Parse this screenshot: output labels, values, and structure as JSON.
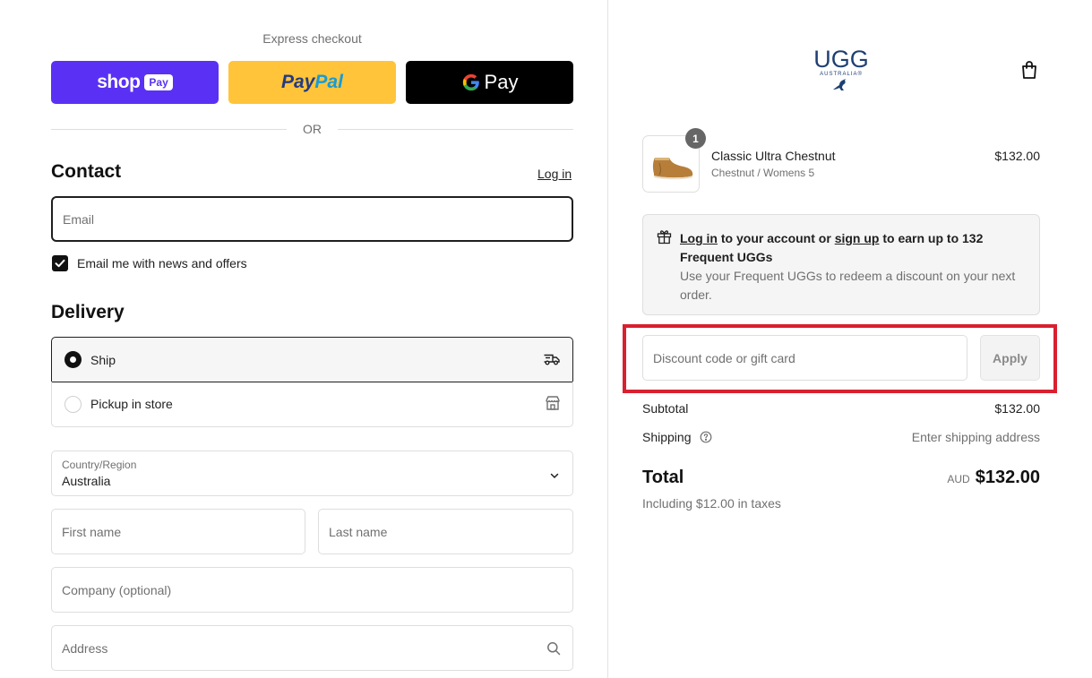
{
  "express": {
    "title": "Express checkout",
    "shop_word": "shop",
    "shop_pill": "Pay",
    "paypal_pay": "Pay",
    "paypal_pal": "Pal",
    "gpay_g": "G",
    "gpay_word": "Pay",
    "or_text": "OR"
  },
  "contact": {
    "title": "Contact",
    "login_link": "Log in",
    "email_placeholder": "Email",
    "newsletter_label": "Email me with news and offers",
    "newsletter_checked": true
  },
  "delivery": {
    "title": "Delivery",
    "options": [
      {
        "label": "Ship",
        "selected": true,
        "icon": "truck-icon"
      },
      {
        "label": "Pickup in store",
        "selected": false,
        "icon": "store-icon"
      }
    ],
    "country_label": "Country/Region",
    "country_value": "Australia",
    "first_name_placeholder": "First name",
    "last_name_placeholder": "Last name",
    "company_placeholder": "Company (optional)",
    "address_placeholder": "Address"
  },
  "brand": {
    "logo_text": "UGG",
    "logo_sub": "AUSTRALIA®",
    "cart_icon": "shopping-bag-icon"
  },
  "order": {
    "item": {
      "name": "Classic Ultra Chestnut",
      "variant": "Chestnut / Womens 5",
      "price": "$132.00",
      "quantity": "1"
    },
    "rewards": {
      "login": "Log in",
      "mid": " to your account or ",
      "signup": "sign up",
      "tail": " to earn up to 132 Frequent UGGs",
      "sub": "Use your Frequent UGGs to redeem a discount on your next order."
    },
    "discount_placeholder": "Discount code or gift card",
    "apply_label": "Apply",
    "subtotal_label": "Subtotal",
    "subtotal_value": "$132.00",
    "shipping_label": "Shipping",
    "shipping_value": "Enter shipping address",
    "total_label": "Total",
    "currency": "AUD",
    "total_value": "$132.00",
    "taxes_note": "Including $12.00 in taxes"
  },
  "colors": {
    "shop_pay": "#5a31f4",
    "paypal": "#ffc439",
    "gpay": "#000000",
    "highlight": "#d9202f",
    "brand_blue": "#1f3f73"
  }
}
